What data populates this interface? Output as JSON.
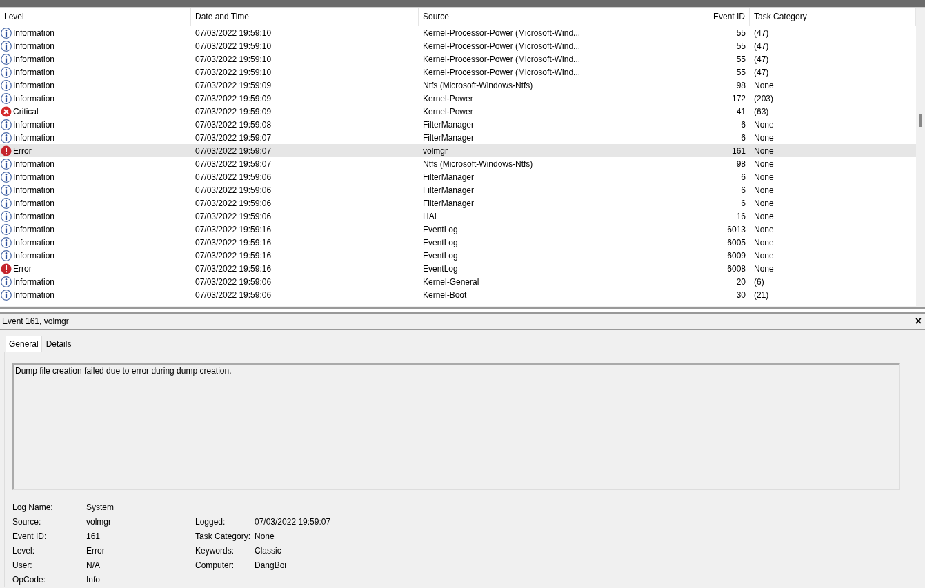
{
  "table": {
    "columns": [
      "Level",
      "Date and Time",
      "Source",
      "Event ID",
      "Task Category"
    ],
    "rows": [
      {
        "kind": "information",
        "level": "Information",
        "date": "07/03/2022 19:59:10",
        "source": "Kernel-Processor-Power (Microsoft-Wind...",
        "event_id": "55",
        "category": "(47)",
        "selected": false
      },
      {
        "kind": "information",
        "level": "Information",
        "date": "07/03/2022 19:59:10",
        "source": "Kernel-Processor-Power (Microsoft-Wind...",
        "event_id": "55",
        "category": "(47)",
        "selected": false
      },
      {
        "kind": "information",
        "level": "Information",
        "date": "07/03/2022 19:59:10",
        "source": "Kernel-Processor-Power (Microsoft-Wind...",
        "event_id": "55",
        "category": "(47)",
        "selected": false
      },
      {
        "kind": "information",
        "level": "Information",
        "date": "07/03/2022 19:59:10",
        "source": "Kernel-Processor-Power (Microsoft-Wind...",
        "event_id": "55",
        "category": "(47)",
        "selected": false
      },
      {
        "kind": "information",
        "level": "Information",
        "date": "07/03/2022 19:59:09",
        "source": "Ntfs (Microsoft-Windows-Ntfs)",
        "event_id": "98",
        "category": "None",
        "selected": false
      },
      {
        "kind": "information",
        "level": "Information",
        "date": "07/03/2022 19:59:09",
        "source": "Kernel-Power",
        "event_id": "172",
        "category": "(203)",
        "selected": false
      },
      {
        "kind": "critical",
        "level": "Critical",
        "date": "07/03/2022 19:59:09",
        "source": "Kernel-Power",
        "event_id": "41",
        "category": "(63)",
        "selected": false
      },
      {
        "kind": "information",
        "level": "Information",
        "date": "07/03/2022 19:59:08",
        "source": "FilterManager",
        "event_id": "6",
        "category": "None",
        "selected": false
      },
      {
        "kind": "information",
        "level": "Information",
        "date": "07/03/2022 19:59:07",
        "source": "FilterManager",
        "event_id": "6",
        "category": "None",
        "selected": false
      },
      {
        "kind": "error",
        "level": "Error",
        "date": "07/03/2022 19:59:07",
        "source": "volmgr",
        "event_id": "161",
        "category": "None",
        "selected": true
      },
      {
        "kind": "information",
        "level": "Information",
        "date": "07/03/2022 19:59:07",
        "source": "Ntfs (Microsoft-Windows-Ntfs)",
        "event_id": "98",
        "category": "None",
        "selected": false
      },
      {
        "kind": "information",
        "level": "Information",
        "date": "07/03/2022 19:59:06",
        "source": "FilterManager",
        "event_id": "6",
        "category": "None",
        "selected": false
      },
      {
        "kind": "information",
        "level": "Information",
        "date": "07/03/2022 19:59:06",
        "source": "FilterManager",
        "event_id": "6",
        "category": "None",
        "selected": false
      },
      {
        "kind": "information",
        "level": "Information",
        "date": "07/03/2022 19:59:06",
        "source": "FilterManager",
        "event_id": "6",
        "category": "None",
        "selected": false
      },
      {
        "kind": "information",
        "level": "Information",
        "date": "07/03/2022 19:59:06",
        "source": "HAL",
        "event_id": "16",
        "category": "None",
        "selected": false
      },
      {
        "kind": "information",
        "level": "Information",
        "date": "07/03/2022 19:59:16",
        "source": "EventLog",
        "event_id": "6013",
        "category": "None",
        "selected": false
      },
      {
        "kind": "information",
        "level": "Information",
        "date": "07/03/2022 19:59:16",
        "source": "EventLog",
        "event_id": "6005",
        "category": "None",
        "selected": false
      },
      {
        "kind": "information",
        "level": "Information",
        "date": "07/03/2022 19:59:16",
        "source": "EventLog",
        "event_id": "6009",
        "category": "None",
        "selected": false
      },
      {
        "kind": "error",
        "level": "Error",
        "date": "07/03/2022 19:59:16",
        "source": "EventLog",
        "event_id": "6008",
        "category": "None",
        "selected": false
      },
      {
        "kind": "information",
        "level": "Information",
        "date": "07/03/2022 19:59:06",
        "source": "Kernel-General",
        "event_id": "20",
        "category": "(6)",
        "selected": false
      },
      {
        "kind": "information",
        "level": "Information",
        "date": "07/03/2022 19:59:06",
        "source": "Kernel-Boot",
        "event_id": "30",
        "category": "(21)",
        "selected": false
      }
    ]
  },
  "details": {
    "title": "Event 161, volmgr",
    "close": "×",
    "tabs": [
      {
        "label": "General",
        "selected": true
      },
      {
        "label": "Details",
        "selected": false
      }
    ],
    "description": "Dump file creation failed due to error during dump creation.",
    "left_fields": [
      {
        "label": "Log Name:",
        "value": "System"
      },
      {
        "label": "Source:",
        "value": "volmgr"
      },
      {
        "label": "Event ID:",
        "value": "161"
      },
      {
        "label": "Level:",
        "value": "Error"
      },
      {
        "label": "User:",
        "value": "N/A"
      },
      {
        "label": "OpCode:",
        "value": "Info"
      }
    ],
    "right_fields": [
      {
        "label": "Logged:",
        "value": "07/03/2022 19:59:07"
      },
      {
        "label": "Task Category:",
        "value": "None"
      },
      {
        "label": "Keywords:",
        "value": "Classic"
      },
      {
        "label": "Computer:",
        "value": "DangBoi"
      }
    ]
  }
}
